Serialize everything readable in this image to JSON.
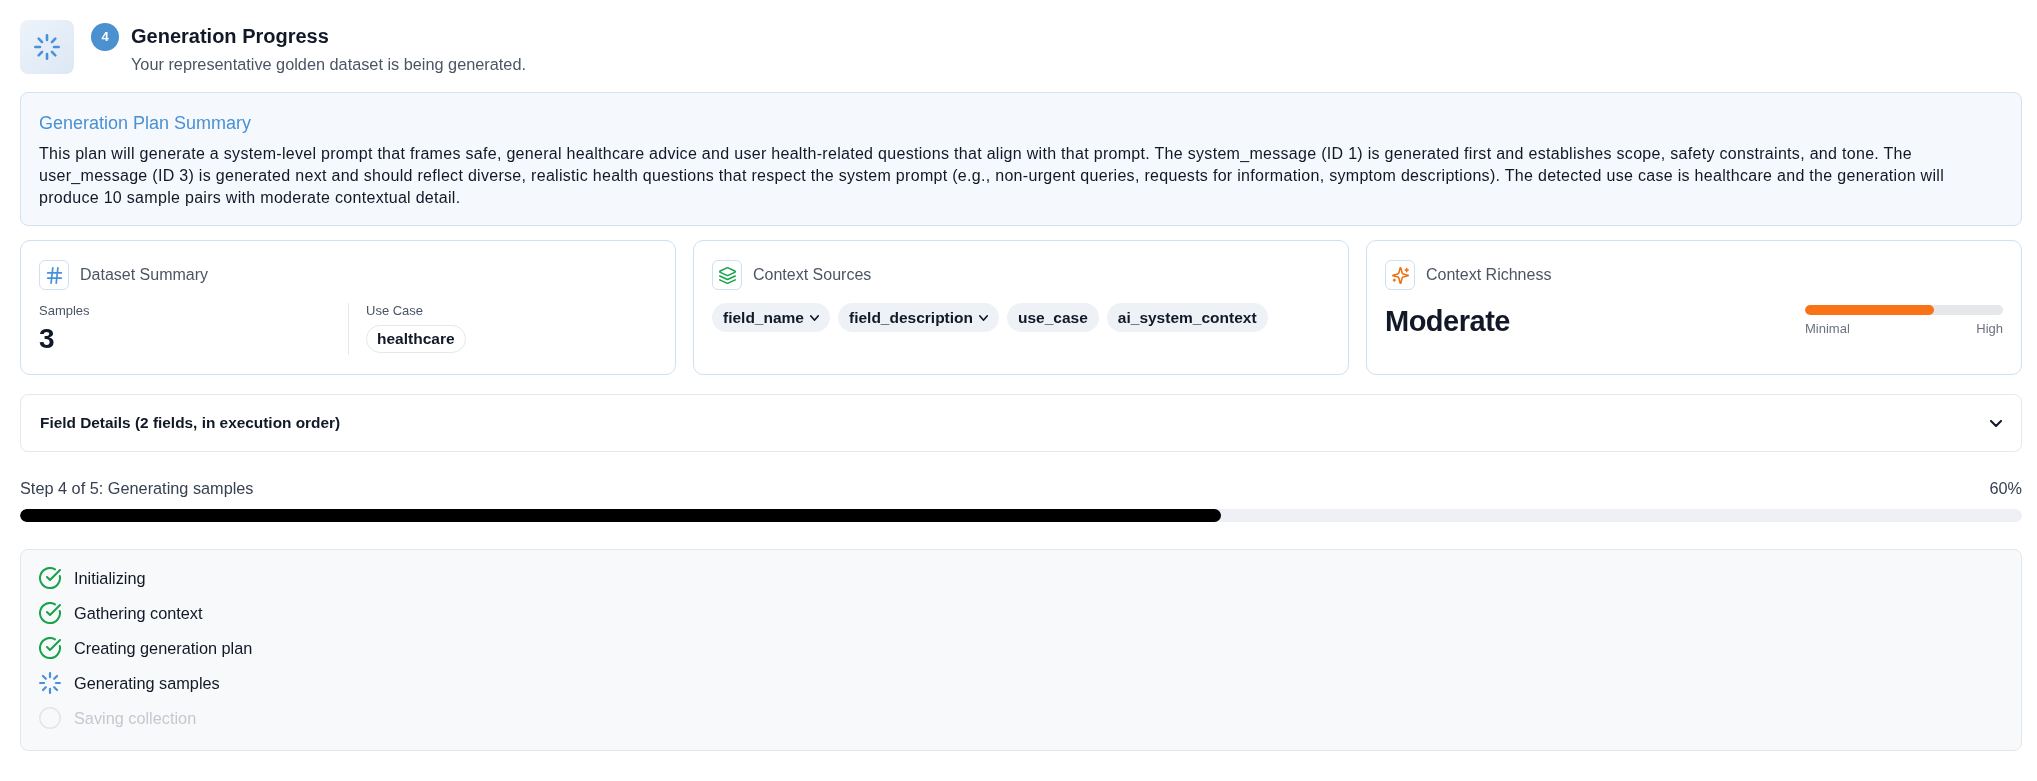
{
  "header": {
    "step_badge": "4",
    "title": "Generation Progress",
    "subtitle": "Your representative golden dataset is being generated."
  },
  "plan_summary": {
    "title": "Generation Plan Summary",
    "text": "This plan will generate a system-level prompt that frames safe, general healthcare advice and user health-related questions that align with that prompt. The system_message (ID 1) is generated first and establishes scope, safety constraints, and tone. The user_message (ID 3) is generated next and should reflect diverse, realistic health questions that respect the system prompt (e.g., non-urgent queries, requests for information, symptom descriptions). The detected use case is healthcare and the generation will produce 10 sample pairs with moderate contextual detail."
  },
  "cards": [
    {
      "kind": "dataset",
      "title": "Dataset Summary",
      "samples_label": "Samples",
      "samples": "3",
      "use_case_label": "Use Case",
      "use_case": "healthcare"
    },
    {
      "kind": "sources",
      "title": "Context Sources",
      "sources": [
        {
          "label": "field_name",
          "expandable": true
        },
        {
          "label": "field_description",
          "expandable": true
        },
        {
          "label": "use_case",
          "expandable": false
        },
        {
          "label": "ai_system_context",
          "expandable": false
        }
      ]
    },
    {
      "kind": "richness",
      "title": "Context Richness",
      "value": "Moderate",
      "level": 0.65,
      "min_label": "Minimal",
      "max_label": "High"
    }
  ],
  "field_details": {
    "label": "Field Details (2 fields, in execution order)",
    "expanded": false
  },
  "progress": {
    "label": "Step 4 of 5: Generating samples",
    "percent": "60%",
    "level": 0.6
  },
  "steps": [
    {
      "label": "Initializing",
      "kind": "done"
    },
    {
      "label": "Gathering context",
      "kind": "done"
    },
    {
      "label": "Creating generation plan",
      "kind": "done"
    },
    {
      "label": "Generating samples",
      "kind": "active"
    },
    {
      "label": "Saving collection",
      "kind": "pending"
    }
  ]
}
